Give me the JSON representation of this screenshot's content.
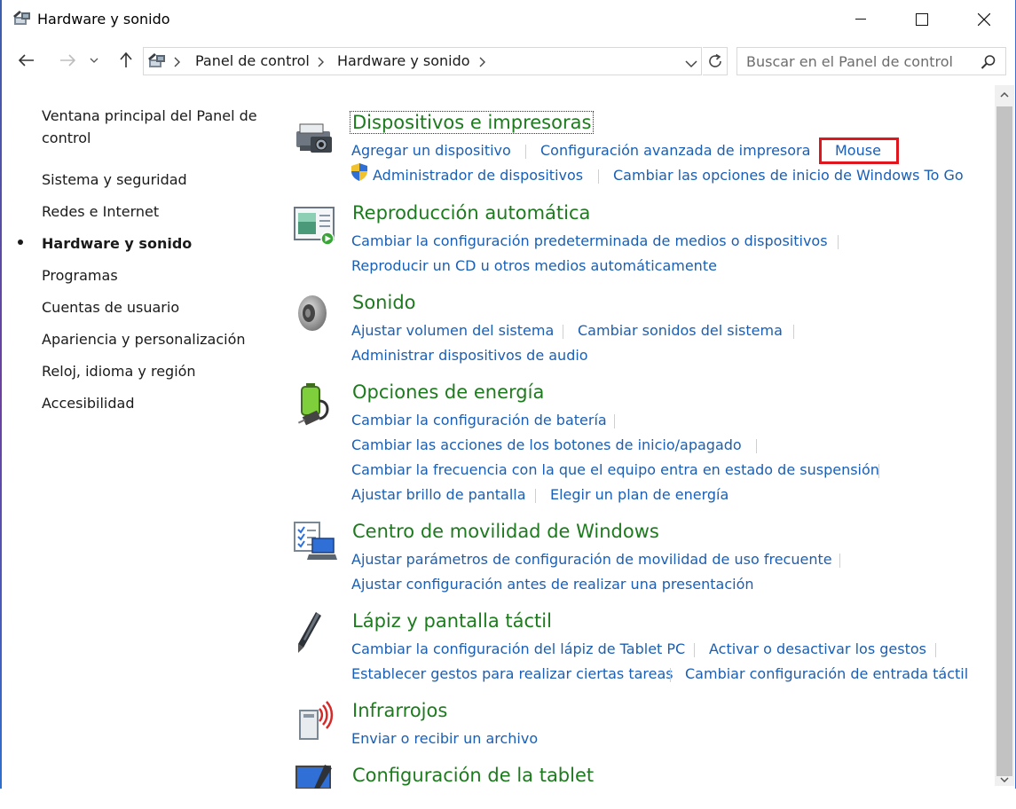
{
  "window": {
    "title": "Hardware y sonido"
  },
  "address": {
    "crumbs": [
      "Panel de control",
      "Hardware y sonido"
    ]
  },
  "search": {
    "placeholder": "Buscar en el Panel de control"
  },
  "sidebar": {
    "items": [
      {
        "label": "Ventana principal del Panel de",
        "label2": "control"
      },
      {
        "label": "Sistema y seguridad"
      },
      {
        "label": "Redes e Internet"
      },
      {
        "label": "Hardware y sonido",
        "active": true
      },
      {
        "label": "Programas"
      },
      {
        "label": "Cuentas de usuario"
      },
      {
        "label": "Apariencia y personalización"
      },
      {
        "label": "Reloj, idioma y región"
      },
      {
        "label": "Accesibilidad"
      }
    ]
  },
  "categories": [
    {
      "title": "Dispositivos e impresoras",
      "icon": "printer-camera-icon",
      "links": [
        "Agregar un dispositivo",
        "Configuración avanzada de impresora",
        "Mouse",
        "Administrador de dispositivos",
        "Cambiar las opciones de inicio de Windows To Go"
      ],
      "highlighted": "Mouse"
    },
    {
      "title": "Reproducción automática",
      "icon": "autoplay-icon",
      "links": [
        "Cambiar la configuración predeterminada de medios o dispositivos",
        "Reproducir un CD u otros medios automáticamente"
      ]
    },
    {
      "title": "Sonido",
      "icon": "speaker-icon",
      "links": [
        "Ajustar volumen del sistema",
        "Cambiar sonidos del sistema",
        "Administrar dispositivos de audio"
      ]
    },
    {
      "title": "Opciones de energía",
      "icon": "battery-plug-icon",
      "links": [
        "Cambiar la configuración de batería",
        "Cambiar las acciones de los botones de inicio/apagado",
        "Cambiar la frecuencia con la que el equipo entra en estado de suspensión",
        "Ajustar brillo de pantalla",
        "Elegir un plan de energía"
      ]
    },
    {
      "title": "Centro de movilidad de Windows",
      "icon": "mobility-laptop-icon",
      "links": [
        "Ajustar parámetros de configuración de movilidad de uso frecuente",
        "Ajustar configuración antes de realizar una presentación"
      ]
    },
    {
      "title": "Lápiz y pantalla táctil",
      "icon": "pen-icon",
      "links": [
        "Cambiar la configuración del lápiz de Tablet PC",
        "Activar o desactivar los gestos",
        "Establecer gestos para realizar ciertas tareas",
        "Cambiar configuración de entrada táctil"
      ]
    },
    {
      "title": "Infrarrojos",
      "icon": "infrared-icon",
      "links": [
        "Enviar o recibir un archivo"
      ]
    },
    {
      "title": "Configuración de la tablet",
      "icon": "tablet-icon",
      "links": []
    }
  ],
  "colors": {
    "category_title": "#1e7a1e",
    "link": "#1a5fb4",
    "highlight": "#e0161e"
  }
}
